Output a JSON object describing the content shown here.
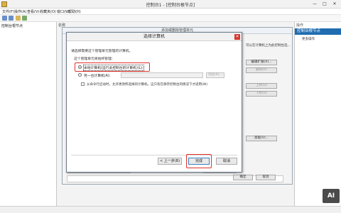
{
  "window": {
    "title": "控制台1 - [控制台根节点]",
    "controls": {
      "minimize": "—",
      "maximize": "□",
      "close": "✕"
    }
  },
  "menubar": {
    "items": [
      "文件(F)",
      "操作(A)",
      "查看(V)",
      "收藏夹(O)",
      "窗口(W)",
      "帮助(H)"
    ]
  },
  "tree": {
    "root_label": "控制台根节点"
  },
  "center": {
    "column_header": "名称"
  },
  "actions": {
    "header": "操作",
    "selected": "控制台根节点",
    "more": "更多操作"
  },
  "snapin_dialog": {
    "title": "添加或删除管理单元",
    "desc_right": "可以在计算机上为此控制台选择可用的管理单元并配置所选的一组扩展。对于可扩展的管理单元，可以配置要启用哪些扩展。",
    "buttons": {
      "edit_ext": "编辑扩展(X)...",
      "remove": "删除(R)",
      "up": "上移(U)",
      "down": "下移(D)",
      "advanced": "高级(V)...",
      "ok": "确定",
      "cancel": "取消"
    }
  },
  "select_dialog": {
    "title": "选择计算机",
    "intro": "请选择需要这个管理单元管理的计算机。",
    "group_label": "这个管理单元将始终管理：",
    "option_local": "本地计算机(运行此控制台的计算机)(L):",
    "option_other": "另一台计算机(A):",
    "browse": "浏览(R)...",
    "checkbox_label": "从命令行启动时，允许更改所选择的计算机。这只有在保存控制台的情况下才适用(W)",
    "buttons": {
      "back": "< 上一步(B)",
      "finish": "完成",
      "cancel": "取消"
    },
    "local_selected": true
  },
  "watermark": {
    "text": "AI"
  },
  "colors": {
    "accent": "#1f6cb0",
    "highlight": "#e0322b",
    "close": "#d9342b"
  }
}
